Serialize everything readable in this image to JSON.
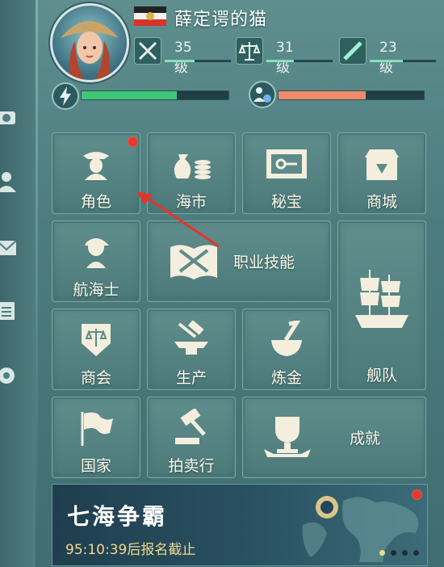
{
  "player": {
    "name": "薛定谔的猫"
  },
  "levels": [
    {
      "icon": "crossed-swords-icon",
      "label": "35级",
      "progress": 0.45
    },
    {
      "icon": "scales-icon",
      "label": "31级",
      "progress": 0.42
    },
    {
      "icon": "spyglass-icon",
      "label": "23级",
      "progress": 0.5
    }
  ],
  "stats": {
    "energy": {
      "icon": "lightning-icon",
      "progress": 0.65,
      "color": "#3fc777"
    },
    "crew": {
      "icon": "crew-icon",
      "progress": 0.6,
      "color": "#f08a6a"
    }
  },
  "tiles": {
    "character": "角色",
    "market": "海市",
    "treasure": "秘宝",
    "store": "商城",
    "navigator": "航海士",
    "skills": "职业技能",
    "fleet": "舰队",
    "guild": "商会",
    "production": "生产",
    "alchemy": "炼金",
    "nation": "国家",
    "auction": "拍卖行",
    "achievement": "成就"
  },
  "banner": {
    "title": "七海争霸",
    "subtitle": "95:10:39后报名截止"
  },
  "colors": {
    "accent": "#f1d98c",
    "badge": "#e53a2e"
  }
}
